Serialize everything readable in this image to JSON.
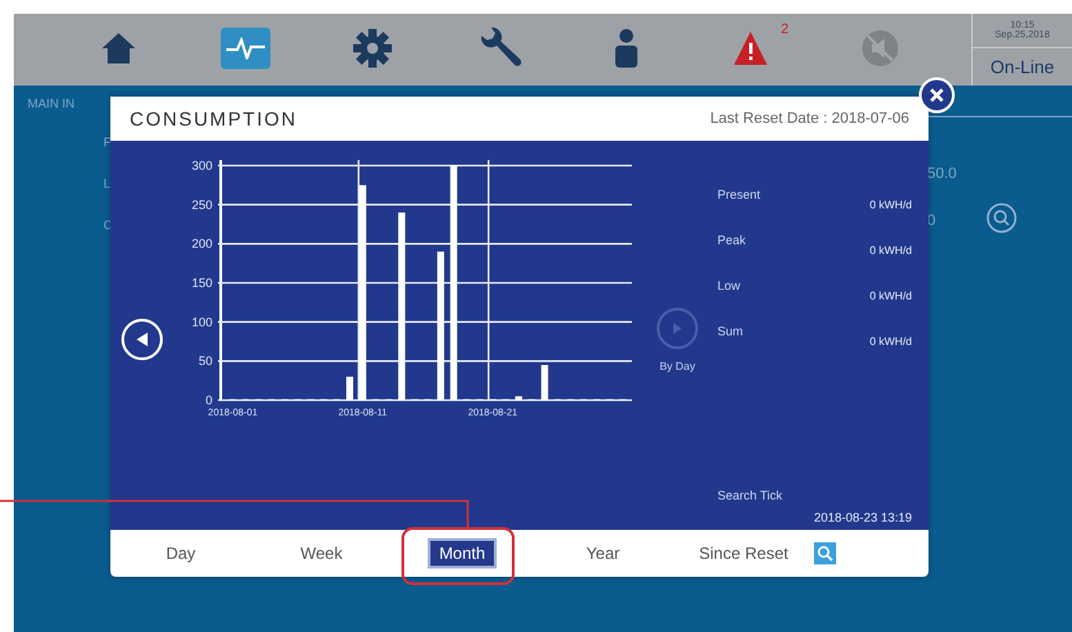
{
  "nav": [
    {
      "kind": "home",
      "selected": false
    },
    {
      "kind": "measurement",
      "selected": true
    },
    {
      "kind": "setup",
      "selected": false
    },
    {
      "kind": "maintenance",
      "selected": false
    },
    {
      "kind": "login",
      "selected": false
    },
    {
      "kind": "warning",
      "selected": false,
      "badge": "2"
    },
    {
      "kind": "mute",
      "selected": false
    }
  ],
  "clock": {
    "time": "10:15",
    "date": "Sep.25,2018"
  },
  "status": "On-Line",
  "background": {
    "section": "MAIN IN",
    "letters": [
      "F",
      "L",
      "C"
    ],
    "values": [
      "50.0",
      "0"
    ]
  },
  "dialog": {
    "title": "CONSUMPTION",
    "reset_date": "Last Reset Date : 2018-07-06",
    "mode_label": "By Day",
    "stats": [
      {
        "label": "Present",
        "value": "0 kWH/d"
      },
      {
        "label": "Peak",
        "value": "0 kWH/d"
      },
      {
        "label": "Low",
        "value": "0 kWH/d"
      },
      {
        "label": "Sum",
        "value": "0 kWH/d"
      }
    ],
    "search_tick": {
      "label": "Search Tick",
      "value": "2018-08-23 13:19"
    },
    "chart_data": {
      "type": "bar",
      "grid": true,
      "categories": [
        "2018-08-01",
        null,
        null,
        null,
        null,
        null,
        null,
        null,
        null,
        null,
        "2018-08-11",
        null,
        null,
        null,
        null,
        null,
        null,
        null,
        null,
        null,
        "2018-08-21",
        null,
        null,
        null,
        null,
        null,
        null,
        null,
        null,
        null,
        null
      ],
      "series": [
        {
          "color": "#ffffff",
          "values": [
            0,
            0,
            0,
            0,
            0,
            0,
            0,
            0,
            0,
            30,
            275,
            0,
            0,
            240,
            0,
            0,
            190,
            300,
            0,
            0,
            0,
            0,
            5,
            0,
            45,
            0,
            0,
            0,
            0,
            0,
            0
          ]
        }
      ],
      "ylim": [
        0,
        300
      ],
      "yticks": [
        0,
        50,
        100,
        150,
        200,
        250,
        300
      ]
    },
    "tabs": [
      {
        "label": "Day",
        "selected": false
      },
      {
        "label": "Week",
        "selected": false
      },
      {
        "label": "Month",
        "selected": true
      },
      {
        "label": "Year",
        "selected": false
      },
      {
        "label": "Since Reset",
        "selected": false
      }
    ]
  }
}
